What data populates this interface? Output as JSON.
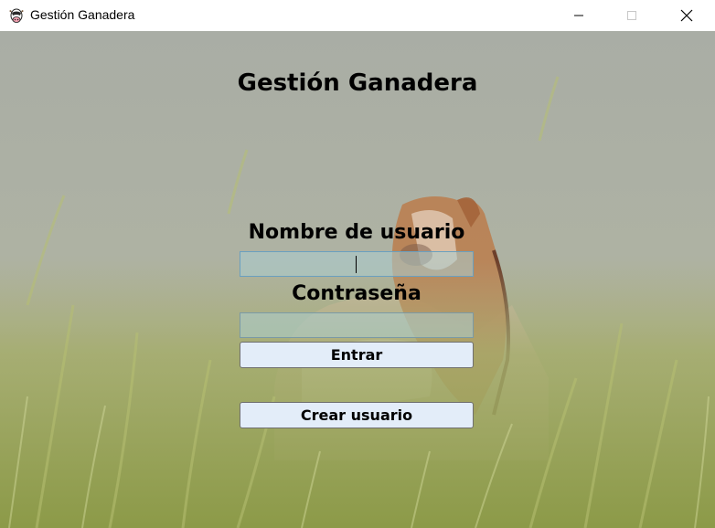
{
  "window": {
    "title": "Gestión Ganadera",
    "icon": "cow-icon",
    "controls": [
      "minimize-icon",
      "maximize-icon",
      "close-icon"
    ]
  },
  "main": {
    "heading": "Gestión Ganadera",
    "username_label": "Nombre de usuario",
    "username_value": "",
    "password_label": "Contraseña",
    "password_value": "",
    "enter_button": "Entrar",
    "create_user_button": "Crear usuario"
  },
  "colors": {
    "button_bg": "#e3edf9",
    "field_bg": "#b5cfd1",
    "sky": "#aeb3a9",
    "grass": "#9aa55a",
    "cow_brown": "#b97a4a"
  }
}
